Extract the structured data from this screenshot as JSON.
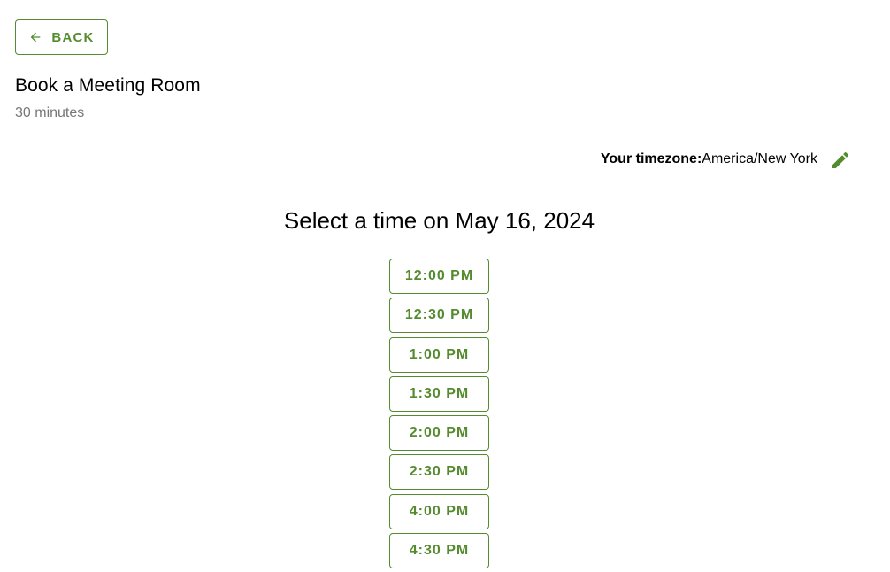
{
  "back_button": {
    "label": "BACK",
    "icon": "arrow-left-icon"
  },
  "event": {
    "title": "Book a Meeting Room",
    "duration": "30 minutes"
  },
  "timezone": {
    "label": "Your timezone:",
    "value": "America/New York",
    "edit_icon": "pencil-icon"
  },
  "heading": "Select a time on May 16, 2024",
  "time_slots": [
    "12:00 PM",
    "12:30 PM",
    "1:00 PM",
    "1:30 PM",
    "2:00 PM",
    "2:30 PM",
    "4:00 PM",
    "4:30 PM"
  ],
  "colors": {
    "accent": "#558b2f",
    "muted_text": "#777777"
  }
}
